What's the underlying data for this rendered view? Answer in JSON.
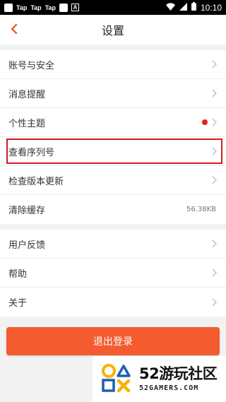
{
  "status_bar": {
    "apps": [
      "Tap",
      "Tap",
      "Tap"
    ],
    "badge": "A",
    "time": "10:10"
  },
  "header": {
    "title": "设置"
  },
  "group1": {
    "items": [
      {
        "label": "账号与安全"
      },
      {
        "label": "消息提醒"
      },
      {
        "label": "个性主题"
      },
      {
        "label": "查看序列号"
      },
      {
        "label": "检查版本更新"
      },
      {
        "label": "清除缓存",
        "value": "56.38KB"
      }
    ]
  },
  "group2": {
    "items": [
      {
        "label": "用户反馈"
      },
      {
        "label": "帮助"
      },
      {
        "label": "关于"
      }
    ]
  },
  "logout": {
    "label": "退出登录"
  },
  "watermark": {
    "big": "52游玩社区",
    "small": "52GAMERS.COM"
  },
  "colors": {
    "accent": "#f45b2f",
    "highlight": "#d9191f",
    "dot": "#e5201a"
  }
}
